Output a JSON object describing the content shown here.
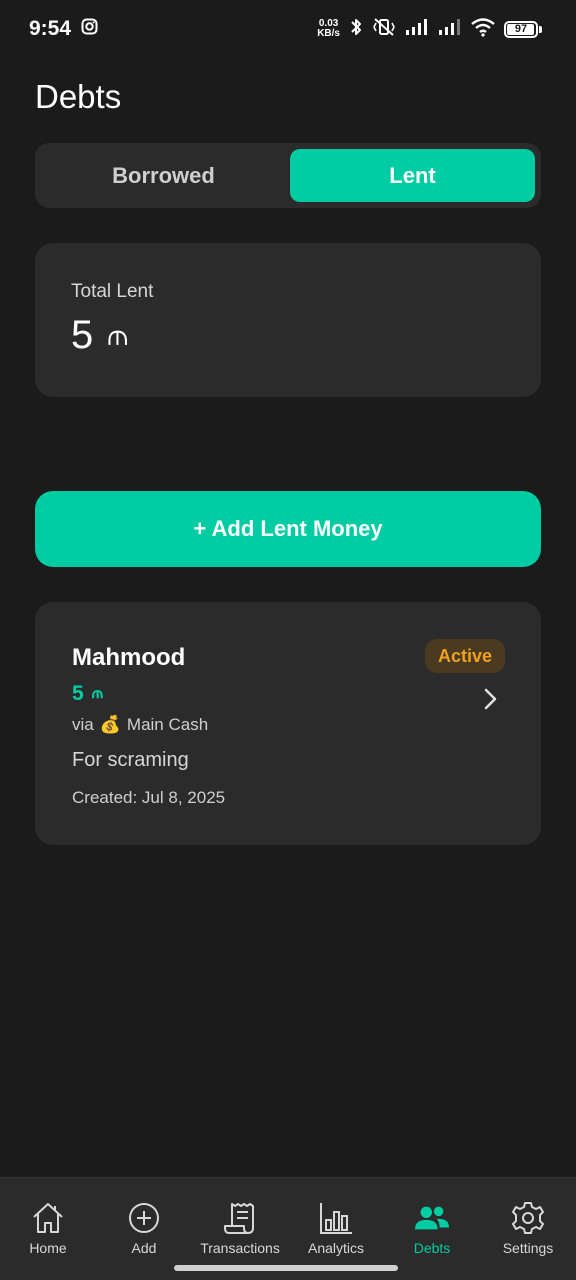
{
  "status_bar": {
    "time": "9:54",
    "net_speed_value": "0.03",
    "net_speed_unit": "KB/s",
    "battery": "97"
  },
  "header": {
    "title": "Debts"
  },
  "tabs": [
    {
      "label": "Borrowed",
      "active": false
    },
    {
      "label": "Lent",
      "active": true
    }
  ],
  "summary": {
    "label": "Total Lent",
    "value": "5",
    "currency": "⫙"
  },
  "add_button": {
    "label": "+ Add Lent Money"
  },
  "debts": [
    {
      "name": "Mahmood",
      "status": "Active",
      "amount": "5",
      "currency": "⫙",
      "via_prefix": "via",
      "via_icon": "💰",
      "via_account": "Main Cash",
      "note": "For scraming",
      "created": "Created: Jul 8, 2025"
    }
  ],
  "bottom_nav": [
    {
      "label": "Home",
      "icon": "home-icon",
      "active": false
    },
    {
      "label": "Add",
      "icon": "plus-circle-icon",
      "active": false
    },
    {
      "label": "Transactions",
      "icon": "receipt-icon",
      "active": false
    },
    {
      "label": "Analytics",
      "icon": "bar-chart-icon",
      "active": false
    },
    {
      "label": "Debts",
      "icon": "people-icon",
      "active": true
    },
    {
      "label": "Settings",
      "icon": "gear-icon",
      "active": false
    }
  ],
  "colors": {
    "accent": "#00cca3",
    "background": "#1b1b1b",
    "card": "#2b2b2b",
    "status_active_text": "#f0a120",
    "status_active_bg": "#4a3a21"
  }
}
